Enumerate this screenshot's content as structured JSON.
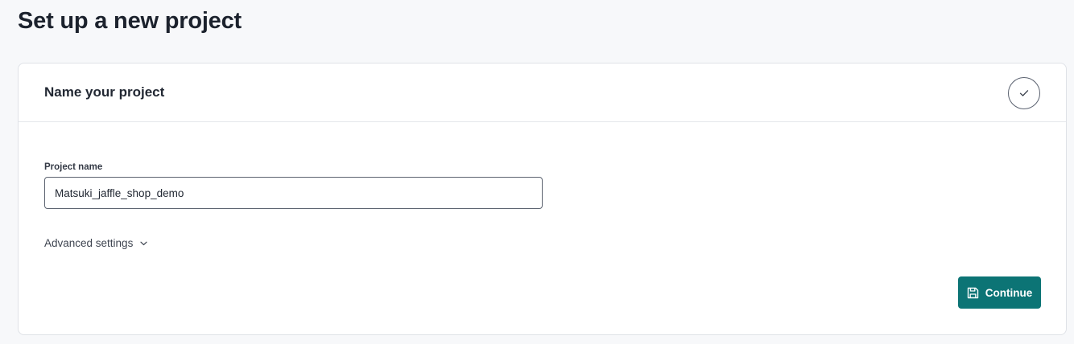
{
  "page": {
    "title": "Set up a new project"
  },
  "step": {
    "title": "Name your project",
    "status_icon": "check-icon"
  },
  "form": {
    "project_name_label": "Project name",
    "project_name_value": "Matsuki_jaffle_shop_demo",
    "advanced_settings_label": "Advanced settings",
    "advanced_settings_icon": "chevron-down-icon"
  },
  "actions": {
    "continue_label": "Continue",
    "continue_icon": "save-icon"
  },
  "colors": {
    "accent": "#0c7475",
    "background": "#f7f8fa",
    "card": "#ffffff",
    "text": "#1c222d"
  }
}
